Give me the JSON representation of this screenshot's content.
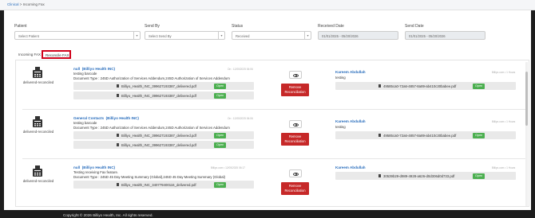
{
  "breadcrumb": {
    "root": "Clinical",
    "separator": ">",
    "current": "Incoming Fax"
  },
  "filters": {
    "patient": {
      "label": "Patient",
      "placeholder": "Select Patient"
    },
    "send_by": {
      "label": "Send By",
      "placeholder": "Select Send By"
    },
    "status": {
      "label": "Status",
      "value": "Received"
    },
    "received_date": {
      "label": "Received Date",
      "value": "01/01/2025 - 05/20/2026"
    },
    "send_date": {
      "label": "Send Date",
      "value": "01/01/2025 - 05/20/2026"
    }
  },
  "tabs": [
    {
      "label": "Incoming FAX",
      "active": false
    },
    {
      "label": "Reconcile FAX",
      "active": true
    }
  ],
  "actions": {
    "remove_line1": "Remove",
    "remove_line2": "Reconciliation",
    "open_label": "Open"
  },
  "cards": [
    {
      "status": "delivered-reconciled",
      "sender_name": "null",
      "sender_org": "(Billiyo Health INC)",
      "received_stamp": "On : 12/05/2025 06:06",
      "line1": "testing barcode",
      "line2": "Document Type : 245D Authorization of Services Addendum,245D Authorization of Services Addendum",
      "files": [
        "Billiyo_Health_INC_399627193387_delivered.pdf",
        "Billiyo_Health_INC_399627193387_delivered.pdf"
      ],
      "recipient_name": "Kareem Abdullah",
      "recipient_stamp": "Billiyo.com • 1 Hours",
      "recipient_note": "testing",
      "recipient_file": "49585ca0-72a6-4857-8a89-ab410c30babee.pdf"
    },
    {
      "status": "delivered-reconciled",
      "sender_name": "General Contacts",
      "sender_org": "(Billiyo Health INC)",
      "received_stamp": "On : 12/05/2025 06:06",
      "line1": "testing barcode",
      "line2": "Document Type : 245D Authorization of Services Addendum,245D Authorization of Services Addendum",
      "files": [
        "Billiyo_Health_INC_399627193387_delivered.pdf",
        "Billiyo_Health_INC_399627193387_delivered.pdf"
      ],
      "recipient_name": "Kareem Abdullah",
      "recipient_stamp": "Billiyo.com • 1 Hours",
      "recipient_note": "testing",
      "recipient_file": "49585ca0-72a6-4857-8a89-ab410c30babee.pdf"
    },
    {
      "status": "delivered-reconciled",
      "sender_name": "null",
      "sender_org": "(Billiyo Health INC)",
      "received_stamp": "Billiyo.com • 12/05/2025 06:17",
      "line1": "Testing receiving Fax feature.",
      "line2": "Document Type : 245D 45 Day Meeting Summary (Global),245D 45 Day Meeting Summary (Global)",
      "files": [
        "Billiyo_Health_INC_340779400116_delivered.pdf"
      ],
      "recipient_name": "Kareem Abdullah",
      "recipient_stamp": "Billiyo.com • 1 Hours",
      "recipient_note": "",
      "recipient_file": "30539b29-d989-4928-a626-d0d306d0d733.pdf"
    }
  ],
  "footer": {
    "copyright": "Copyright © 2026 Billiyo Health, Inc. All rights reserved."
  }
}
